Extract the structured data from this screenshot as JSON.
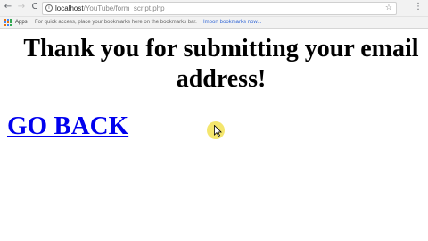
{
  "browser": {
    "toolbar": {
      "back_glyph": "←",
      "forward_glyph": "→",
      "reload_glyph": "C",
      "url_host": "localhost",
      "url_path": "/YouTube/form_script.php",
      "star_glyph": "☆",
      "menu_glyph": "⋮"
    },
    "bookmarks": {
      "apps_label": "Apps",
      "hint": "For quick access, place your bookmarks here on the bookmarks bar.",
      "import_link": "Import bookmarks now..."
    }
  },
  "page": {
    "heading_line1": "Thank you for submitting your email",
    "heading_line2": "address!",
    "go_back_link": "GO BACK"
  },
  "colors": {
    "link": "#0000ee",
    "cursor_highlight": "#f0de3c"
  }
}
